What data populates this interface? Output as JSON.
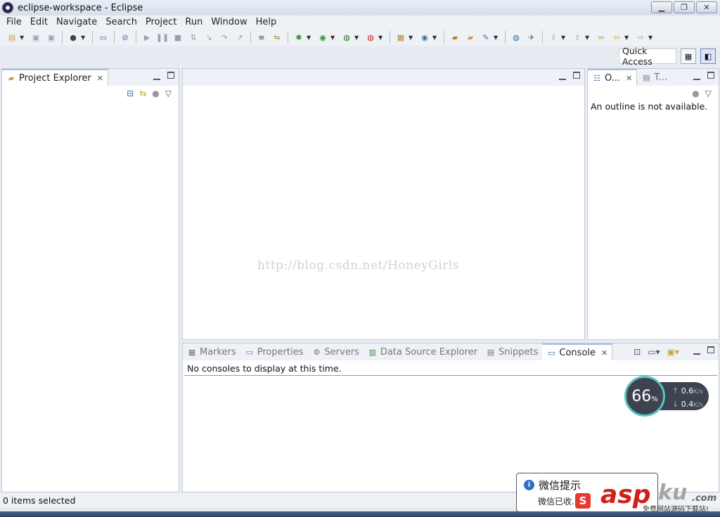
{
  "window": {
    "title": "eclipse-workspace - Eclipse",
    "minimize": "▁",
    "restore": "❐",
    "close": "✕"
  },
  "menu": [
    "File",
    "Edit",
    "Navigate",
    "Search",
    "Project",
    "Run",
    "Window",
    "Help"
  ],
  "toolbar": {
    "quick_access": "Quick Access"
  },
  "project_explorer": {
    "tab_label": "Project Explorer"
  },
  "outline": {
    "tab_label": "O...",
    "tab2_label": "T...",
    "message": "An outline is not available."
  },
  "editor": {
    "watermark": "http://blog.csdn.net/HoneyGirls"
  },
  "bottom_tabs": [
    {
      "label": "Markers",
      "active": false
    },
    {
      "label": "Properties",
      "active": false
    },
    {
      "label": "Servers",
      "active": false
    },
    {
      "label": "Data Source Explorer",
      "active": false
    },
    {
      "label": "Snippets",
      "active": false
    },
    {
      "label": "Console",
      "active": true
    }
  ],
  "console": {
    "message": "No consoles to display at this time."
  },
  "status": {
    "text": "0 items selected"
  },
  "speed": {
    "percent": "66",
    "percent_unit": "%",
    "up": "0.6",
    "down": "0.4",
    "unit": "K/s"
  },
  "wechat": {
    "title": "微信提示",
    "body": "微信已收..."
  },
  "logo": {
    "badge": "S",
    "asp": "asp",
    "ku": "ku",
    "com": ".com",
    "sub": "免费网站源码下载站!"
  }
}
